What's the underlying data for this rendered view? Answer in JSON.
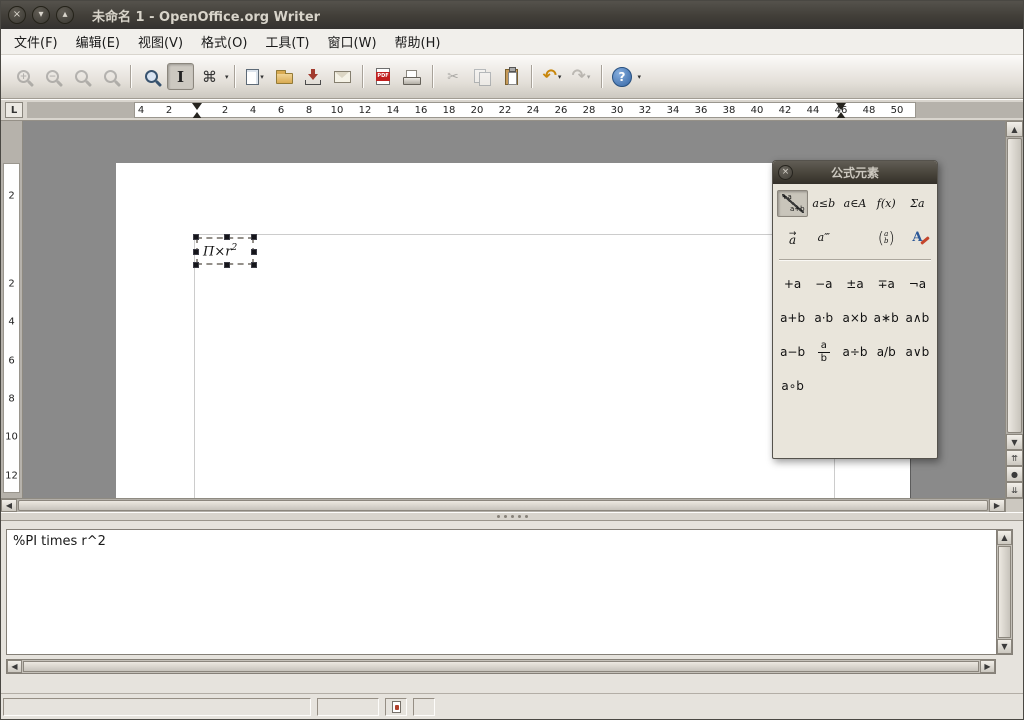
{
  "window": {
    "title": "未命名 1 - OpenOffice.org Writer",
    "controls": {
      "close": "×",
      "minimize": "▾",
      "maximize": "▴"
    }
  },
  "menubar": {
    "items": [
      "文件(F)",
      "编辑(E)",
      "视图(V)",
      "格式(O)",
      "工具(T)",
      "窗口(W)",
      "帮助(H)"
    ]
  },
  "toolbar": {
    "glyphs": {
      "plus": "+",
      "minus": "−",
      "ibeam": "I",
      "symbols": "⌘",
      "cut": "✂",
      "undo": "↶",
      "redo": "↷",
      "help": "?",
      "pdf": "PDF",
      "dd": "▾",
      "left": "◀",
      "right": "▶",
      "up": "▲",
      "down": "▼",
      "nav_up": "⇈",
      "nav_dot": "●",
      "nav_down": "⇊"
    }
  },
  "hruler": {
    "numbers": [
      "4",
      "2",
      "",
      "2",
      "4",
      "6",
      "8",
      "10",
      "12",
      "14",
      "16",
      "18",
      "20",
      "22",
      "24",
      "26",
      "28",
      "30",
      "32",
      "34",
      "36",
      "38",
      "40",
      "42",
      "44",
      "46",
      "48",
      "50"
    ]
  },
  "vruler": {
    "numbers": [
      "2",
      "2",
      "4",
      "6",
      "8",
      "10",
      "12"
    ]
  },
  "tab_stop": {
    "label": "L"
  },
  "document": {
    "formula_base": "Π×r",
    "formula_sup": "2"
  },
  "palette": {
    "title": "公式元素",
    "close": "×",
    "cat_unary_top": "+a",
    "cat_unary_bottom": "a+b",
    "cat_relations": "a≤b",
    "cat_sets": "a∈A",
    "cat_functions": "f(x)",
    "cat_operators": "Σa",
    "cat_attr_mark": "→",
    "cat_attr_base": "a",
    "cat_others": "a‴",
    "cat_brackets_open": "(",
    "cat_brackets_top": "a",
    "cat_brackets_bottom": "b",
    "cat_brackets_close": ")",
    "cat_formats": "A",
    "ops": [
      "+a",
      "−a",
      "±a",
      "∓a",
      "¬a",
      "a+b",
      "a⋅b",
      "a×b",
      "a∗b",
      "a∧b",
      "a−b",
      "a÷b",
      "a/b",
      "a∨b",
      "a∘b"
    ],
    "frac_num": "a",
    "frac_den": "b"
  },
  "commands": {
    "text": "%PI times r^2"
  }
}
